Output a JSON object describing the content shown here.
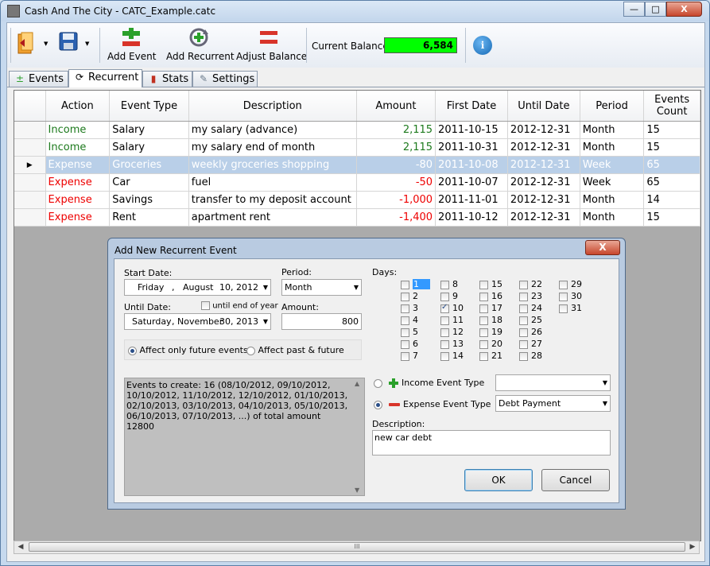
{
  "window": {
    "title": "Cash And The City - CATC_Example.catc",
    "minimize": "—",
    "maximize": "□",
    "close": "X"
  },
  "toolbar": {
    "add_event": "Add Event",
    "add_recurrent": "Add Recurrent",
    "adjust_balance": "Adjust Balance",
    "balance_label": "Current Balance:",
    "balance_value": "6,584",
    "balance_color": "#00ff00",
    "info_glyph": "i"
  },
  "tabs": [
    {
      "label": "Events",
      "icon": "events-icon"
    },
    {
      "label": "Recurrent",
      "icon": "refresh-icon"
    },
    {
      "label": "Stats",
      "icon": "bar-chart-icon"
    },
    {
      "label": "Settings",
      "icon": "wrench-icon"
    }
  ],
  "grid": {
    "headers": [
      "Action",
      "Event Type",
      "Description",
      "Amount",
      "First Date",
      "Until Date",
      "Period",
      "Events Count"
    ],
    "rows": [
      {
        "action": "Income",
        "type": "Salary",
        "desc": "my salary (advance)",
        "amount": "2,115",
        "first": "2011-10-15",
        "until": "2012-12-31",
        "period": "Month",
        "count": "15"
      },
      {
        "action": "Income",
        "type": "Salary",
        "desc": "my salary end of month",
        "amount": "2,115",
        "first": "2011-10-31",
        "until": "2012-12-31",
        "period": "Month",
        "count": "15"
      },
      {
        "action": "Expense",
        "type": "Groceries",
        "desc": "weekly groceries shopping",
        "amount": "-80",
        "first": "2011-10-08",
        "until": "2012-12-31",
        "period": "Week",
        "count": "65"
      },
      {
        "action": "Expense",
        "type": "Car",
        "desc": "fuel",
        "amount": "-50",
        "first": "2011-10-07",
        "until": "2012-12-31",
        "period": "Week",
        "count": "65"
      },
      {
        "action": "Expense",
        "type": "Savings",
        "desc": "transfer to my deposit account",
        "amount": "-1,000",
        "first": "2011-11-01",
        "until": "2012-12-31",
        "period": "Month",
        "count": "14"
      },
      {
        "action": "Expense",
        "type": "Rent",
        "desc": "apartment rent",
        "amount": "-1,400",
        "first": "2011-10-12",
        "until": "2012-12-31",
        "period": "Month",
        "count": "15"
      }
    ],
    "selected_marker": "▶",
    "scroll_thumb_grip": "III"
  },
  "dialog": {
    "title": "Add New Recurrent Event",
    "close": "X",
    "start_date_label": "Start Date:",
    "start_date": {
      "weekday": "Friday",
      "sep": ",",
      "month": "August",
      "day": "10, 2012"
    },
    "until_date_label": "Until Date:",
    "until_end_of_year": "until end of year",
    "until_date": {
      "weekday": "Saturday",
      "sep": ",",
      "month": "November",
      "day": "30, 2013"
    },
    "period_label": "Period:",
    "period_value": "Month",
    "amount_label": "Amount:",
    "amount_value": "800",
    "affect_future": "Affect only future events",
    "affect_past": "Affect past & future",
    "summary": "Events to create: 16 (08/10/2012, 09/10/2012, 10/10/2012, 11/10/2012, 12/10/2012, 01/10/2013, 02/10/2013, 03/10/2013, 04/10/2013, 05/10/2013, 06/10/2013, 07/10/2013, ...) of total amount 12800",
    "days_label": "Days:",
    "checked_day": "10",
    "income_type_label": "Income Event Type",
    "income_type_value": "",
    "expense_type_label": "Expense Event Type",
    "expense_type_value": "Debt Payment",
    "description_label": "Description:",
    "description_value": "new car debt",
    "ok": "OK",
    "cancel": "Cancel"
  }
}
